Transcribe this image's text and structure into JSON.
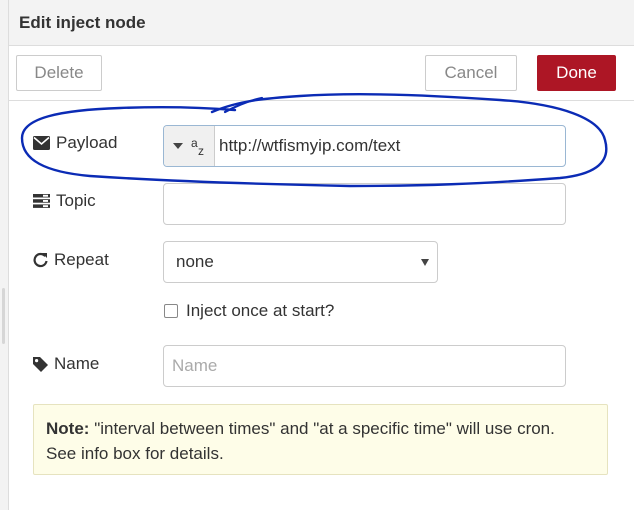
{
  "header": {
    "title": "Edit inject node"
  },
  "toolbar": {
    "delete_label": "Delete",
    "cancel_label": "Cancel",
    "done_label": "Done"
  },
  "payload": {
    "label": "Payload",
    "type_icon": "string-type-icon",
    "value": "http://wtfismyip.com/text"
  },
  "topic": {
    "label": "Topic",
    "value": ""
  },
  "repeat": {
    "label": "Repeat",
    "selected": "none"
  },
  "inject_once": {
    "label": "Inject once at start?",
    "checked": false
  },
  "name": {
    "label": "Name",
    "placeholder": "Name",
    "value": ""
  },
  "note": {
    "title": "Note:",
    "text": "\"interval between times\" and \"at a specific time\" will use cron.",
    "text2": "See info box for details."
  },
  "colors": {
    "done_button": "#ad1625",
    "note_bg": "#fefde8",
    "annotation": "#0b2bb5"
  }
}
